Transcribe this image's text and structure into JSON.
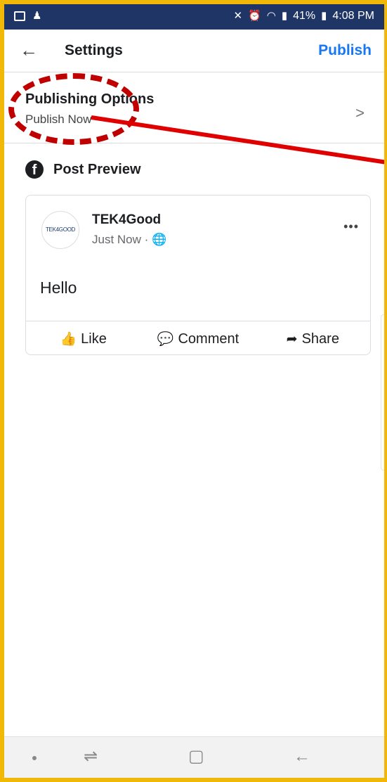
{
  "statusbar": {
    "battery": "41%",
    "time": "4:08 PM",
    "left_icons": [
      "image-icon",
      "notification-icon"
    ],
    "right_icons": [
      "mute-icon",
      "alarm-icon",
      "wifi-icon",
      "signal-icon",
      "battery-icon"
    ]
  },
  "header": {
    "back_icon": "back-arrow-icon",
    "title": "Settings",
    "publish_label": "Publish"
  },
  "publishing_options": {
    "title": "Publishing Options",
    "value": "Publish Now"
  },
  "preview": {
    "title": "Post Preview",
    "post": {
      "author": "TEK4Good",
      "avatar_text": "TEK4GOOD",
      "time": "Just Now",
      "visibility_icon": "globe-icon",
      "body": "Hello"
    },
    "actions": [
      {
        "label": "Like",
        "icon": "thumbs-up-icon"
      },
      {
        "label": "Comment",
        "icon": "comment-icon"
      },
      {
        "label": "Share",
        "icon": "share-icon"
      }
    ]
  },
  "colors": {
    "accent": "#1877f2",
    "statusbar": "#1f3566",
    "annotation": "#c00000",
    "frame": "#f2b807"
  }
}
